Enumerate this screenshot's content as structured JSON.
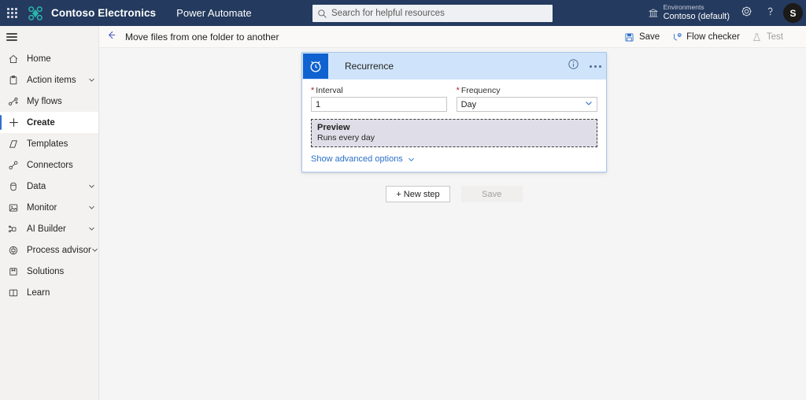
{
  "suitebar": {
    "waffle_icon": "waffle-grid-icon",
    "brand_logo_icon": "contoso-drone-logo",
    "brand_name": "Contoso Electronics",
    "app_name": "Power Automate",
    "search": {
      "icon": "search-icon",
      "placeholder": "Search for helpful resources",
      "value": ""
    },
    "environment": {
      "icon": "environment-icon",
      "label": "Environments",
      "value": "Contoso (default)"
    },
    "settings_icon": "gear-icon",
    "help_icon": "question-mark-icon",
    "avatar_initial": "S",
    "background": "#243a5e"
  },
  "sidebar": {
    "hamburger_icon": "hamburger-menu-icon",
    "items": [
      {
        "label": "Home",
        "icon": "home-icon",
        "expandable": false,
        "selected": false
      },
      {
        "label": "Action items",
        "icon": "clipboard-icon",
        "expandable": true,
        "selected": false
      },
      {
        "label": "My flows",
        "icon": "flow-icon",
        "expandable": false,
        "selected": false
      },
      {
        "label": "Create",
        "icon": "plus-icon",
        "expandable": false,
        "selected": true
      },
      {
        "label": "Templates",
        "icon": "templates-icon",
        "expandable": false,
        "selected": false
      },
      {
        "label": "Connectors",
        "icon": "connectors-icon",
        "expandable": false,
        "selected": false
      },
      {
        "label": "Data",
        "icon": "database-icon",
        "expandable": true,
        "selected": false
      },
      {
        "label": "Monitor",
        "icon": "monitor-icon",
        "expandable": true,
        "selected": false
      },
      {
        "label": "AI Builder",
        "icon": "ai-builder-icon",
        "expandable": true,
        "selected": false
      },
      {
        "label": "Process advisor",
        "icon": "process-advisor-icon",
        "expandable": true,
        "selected": false
      },
      {
        "label": "Solutions",
        "icon": "solutions-icon",
        "expandable": false,
        "selected": false
      },
      {
        "label": "Learn",
        "icon": "learn-book-icon",
        "expandable": false,
        "selected": false
      }
    ],
    "accent_color": "#2f6fd0"
  },
  "commandbar": {
    "back_icon": "back-arrow-icon",
    "flow_title": "Move files from one folder to another",
    "actions": [
      {
        "label": "Save",
        "icon": "save-disk-icon",
        "disabled": false
      },
      {
        "label": "Flow checker",
        "icon": "flow-checker-icon",
        "disabled": false
      },
      {
        "label": "Test",
        "icon": "test-flask-icon",
        "disabled": true
      }
    ]
  },
  "card": {
    "icon": "alarm-clock-icon",
    "title": "Recurrence",
    "info_icon": "info-circle-icon",
    "more_icon": "ellipsis-icon",
    "header_color": "#cfe4fb",
    "icon_tile_color": "#0f62d0",
    "fields": {
      "interval": {
        "label": "Interval",
        "required_marker": "*",
        "value": "1"
      },
      "frequency": {
        "label": "Frequency",
        "required_marker": "*",
        "value": "Day",
        "chevron_icon": "chevron-down-icon"
      }
    },
    "preview": {
      "title": "Preview",
      "text": "Runs every day"
    },
    "advanced": {
      "label": "Show advanced options",
      "chevron_icon": "chevron-down-icon"
    }
  },
  "footer_buttons": {
    "new_step": "+ New step",
    "save": "Save"
  }
}
